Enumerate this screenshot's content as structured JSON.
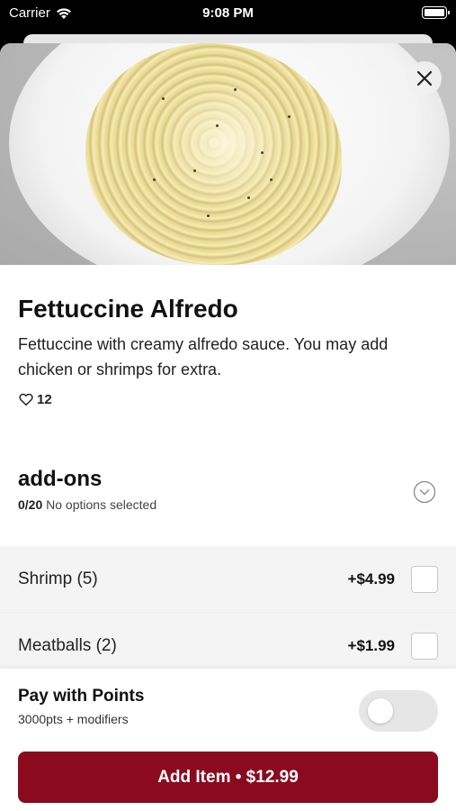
{
  "status_bar": {
    "carrier": "Carrier",
    "time": "9:08 PM"
  },
  "item": {
    "title": "Fettuccine Alfredo",
    "description": "Fettuccine with creamy alfredo sauce. You may add chicken or shrimps for extra.",
    "likes": "12"
  },
  "addons": {
    "title": "add-ons",
    "count": "0/20",
    "status": "No options selected",
    "options": [
      {
        "name": "Shrimp (5)",
        "price": "+$4.99",
        "checked": false
      },
      {
        "name": "Meatballs (2)",
        "price": "+$1.99",
        "checked": false
      }
    ]
  },
  "points": {
    "title": "Pay with Points",
    "subtitle": "3000pts + modifiers",
    "enabled": false
  },
  "add_button": {
    "label": "Add Item • $12.99"
  },
  "colors": {
    "accent": "#8b0a1e",
    "toggle_off": "#e6e6e6"
  },
  "icons": [
    "wifi-icon",
    "battery-icon",
    "close-icon",
    "heart-icon",
    "chevron-down-icon"
  ]
}
